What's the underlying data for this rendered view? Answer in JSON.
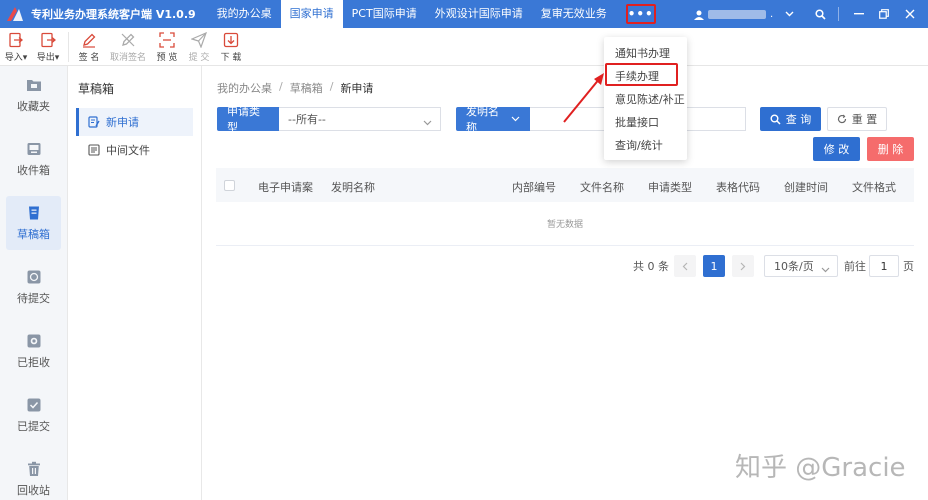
{
  "header": {
    "app_title": "专利业务办理系统客户端 V1.0.9",
    "tabs": [
      {
        "label": "我的办公桌"
      },
      {
        "label": "国家申请"
      },
      {
        "label": "PCT国际申请"
      },
      {
        "label": "外观设计国际申请"
      },
      {
        "label": "复审无效业务"
      }
    ],
    "active_tab": "国家申请",
    "more_label": "•••",
    "user_dot": ".",
    "accent": "#3a78d6"
  },
  "toolbar": {
    "items": [
      {
        "label": "导入▾",
        "icon": "import-icon"
      },
      {
        "label": "导出▾",
        "icon": "export-icon"
      },
      {
        "label": "签 名",
        "icon": "sign-pen-icon"
      },
      {
        "label": "取消签名",
        "icon": "cancel-sign-icon"
      },
      {
        "label": "预 览",
        "icon": "preview-icon"
      },
      {
        "label": "提 交",
        "icon": "send-icon"
      },
      {
        "label": "下 载",
        "icon": "download-icon"
      }
    ]
  },
  "sidebar": {
    "items": [
      {
        "label": "收藏夹",
        "icon": "folder-icon"
      },
      {
        "label": "收件箱",
        "icon": "inbox-icon"
      },
      {
        "label": "草稿箱",
        "icon": "draft-icon"
      },
      {
        "label": "待提交",
        "icon": "pending-icon"
      },
      {
        "label": "已拒收",
        "icon": "rejected-icon"
      },
      {
        "label": "已提交",
        "icon": "submitted-icon"
      },
      {
        "label": "回收站",
        "icon": "trash-icon"
      }
    ],
    "active": "草稿箱"
  },
  "subnav": {
    "title": "草稿箱",
    "items": [
      {
        "label": "新申请",
        "icon": "edit-doc-icon"
      },
      {
        "label": "中间文件",
        "icon": "file-icon"
      }
    ],
    "active": "新申请"
  },
  "breadcrumb": [
    "我的办公桌",
    "草稿箱",
    "新申请"
  ],
  "filters": {
    "type_label": "申请类型",
    "type_value": "--所有--",
    "field_label": "发明名称",
    "field_value": "",
    "search_label": "查 询",
    "reset_label": "重 置"
  },
  "actions": {
    "edit_label": "修 改",
    "delete_label": "删 除"
  },
  "table": {
    "columns": [
      "电子申请案",
      "发明名称",
      "内部编号",
      "文件名称",
      "申请类型",
      "表格代码",
      "创建时间",
      "文件格式"
    ],
    "empty_text": "暂无数据"
  },
  "pagination": {
    "total_text": "共 0 条",
    "current_page": "1",
    "page_size": "10条/页",
    "goto_prefix": "前往",
    "goto_value": "1",
    "goto_suffix": "页"
  },
  "dropdown": {
    "items": [
      "通知书办理",
      "手续办理",
      "意见陈述/补正",
      "批量接口",
      "查询/统计"
    ],
    "highlighted": "手续办理"
  },
  "watermark": "知乎 @Gracie"
}
